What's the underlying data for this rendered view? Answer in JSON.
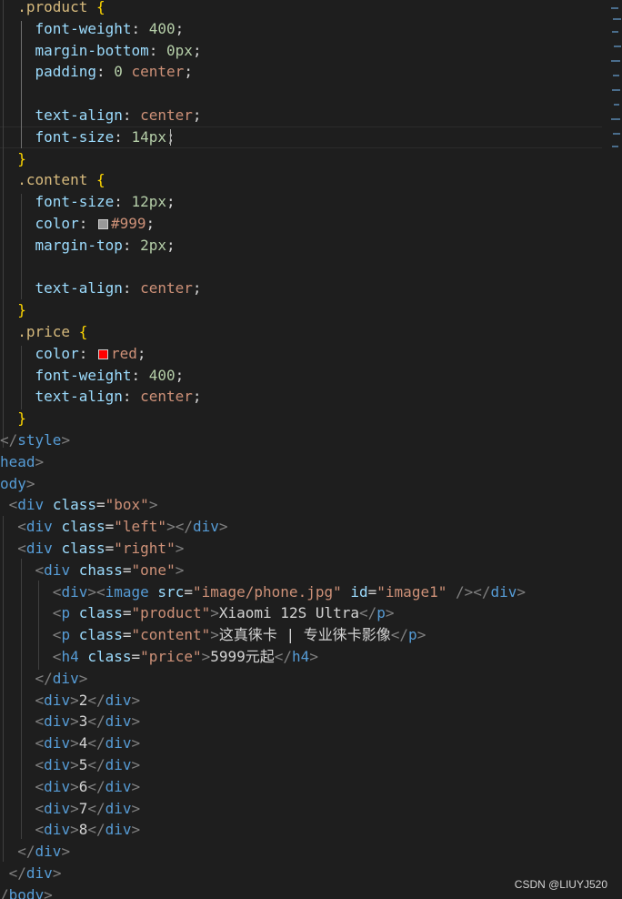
{
  "editor": {
    "lines": [
      {
        "indent": "  ",
        "tokens": [
          [
            "sel",
            ".product "
          ],
          [
            "brace",
            "{"
          ]
        ]
      },
      {
        "indent": "    ",
        "tokens": [
          [
            "prop",
            "font-weight"
          ],
          [
            "txt",
            ": "
          ],
          [
            "num",
            "400"
          ],
          [
            "txt",
            ";"
          ]
        ]
      },
      {
        "indent": "    ",
        "tokens": [
          [
            "prop",
            "margin-bottom"
          ],
          [
            "txt",
            ": "
          ],
          [
            "num",
            "0px"
          ],
          [
            "txt",
            ";"
          ]
        ]
      },
      {
        "indent": "    ",
        "tokens": [
          [
            "prop",
            "padding"
          ],
          [
            "txt",
            ": "
          ],
          [
            "num",
            "0"
          ],
          [
            "txt",
            " "
          ],
          [
            "val",
            "center"
          ],
          [
            "txt",
            ";"
          ]
        ]
      },
      {
        "indent": "",
        "tokens": []
      },
      {
        "indent": "    ",
        "tokens": [
          [
            "prop",
            "text-align"
          ],
          [
            "txt",
            ": "
          ],
          [
            "val",
            "center"
          ],
          [
            "txt",
            ";"
          ]
        ]
      },
      {
        "indent": "    ",
        "tokens": [
          [
            "prop",
            "font-size"
          ],
          [
            "txt",
            ": "
          ],
          [
            "num",
            "14px"
          ],
          [
            "txt",
            ";"
          ]
        ]
      },
      {
        "indent": "  ",
        "tokens": [
          [
            "brace",
            "}"
          ]
        ]
      },
      {
        "indent": "  ",
        "tokens": [
          [
            "sel",
            ".content "
          ],
          [
            "brace",
            "{"
          ]
        ]
      },
      {
        "indent": "    ",
        "tokens": [
          [
            "prop",
            "font-size"
          ],
          [
            "txt",
            ": "
          ],
          [
            "num",
            "12px"
          ],
          [
            "txt",
            ";"
          ]
        ]
      },
      {
        "indent": "    ",
        "tokens": [
          [
            "prop",
            "color"
          ],
          [
            "txt",
            ": "
          ],
          [
            "swatch",
            "#999999"
          ],
          [
            "val",
            "#999"
          ],
          [
            "txt",
            ";"
          ]
        ]
      },
      {
        "indent": "    ",
        "tokens": [
          [
            "prop",
            "margin-top"
          ],
          [
            "txt",
            ": "
          ],
          [
            "num",
            "2px"
          ],
          [
            "txt",
            ";"
          ]
        ]
      },
      {
        "indent": "",
        "tokens": []
      },
      {
        "indent": "    ",
        "tokens": [
          [
            "prop",
            "text-align"
          ],
          [
            "txt",
            ": "
          ],
          [
            "val",
            "center"
          ],
          [
            "txt",
            ";"
          ]
        ]
      },
      {
        "indent": "  ",
        "tokens": [
          [
            "brace",
            "}"
          ]
        ]
      },
      {
        "indent": "  ",
        "tokens": [
          [
            "sel",
            ".price "
          ],
          [
            "brace",
            "{"
          ]
        ]
      },
      {
        "indent": "    ",
        "tokens": [
          [
            "prop",
            "color"
          ],
          [
            "txt",
            ": "
          ],
          [
            "swatch",
            "#ff0000"
          ],
          [
            "val",
            "red"
          ],
          [
            "txt",
            ";"
          ]
        ]
      },
      {
        "indent": "    ",
        "tokens": [
          [
            "prop",
            "font-weight"
          ],
          [
            "txt",
            ": "
          ],
          [
            "num",
            "400"
          ],
          [
            "txt",
            ";"
          ]
        ]
      },
      {
        "indent": "    ",
        "tokens": [
          [
            "prop",
            "text-align"
          ],
          [
            "txt",
            ": "
          ],
          [
            "val",
            "center"
          ],
          [
            "txt",
            ";"
          ]
        ]
      },
      {
        "indent": "  ",
        "tokens": [
          [
            "brace",
            "}"
          ]
        ]
      },
      {
        "indent": "",
        "tokens": [
          [
            "bracket",
            "</"
          ],
          [
            "tag",
            "style"
          ],
          [
            "bracket",
            ">"
          ]
        ]
      },
      {
        "indent": "",
        "tokens": [
          [
            "tag",
            "head"
          ],
          [
            "bracket",
            ">"
          ]
        ]
      },
      {
        "indent": "",
        "tokens": [
          [
            "tag",
            "ody"
          ],
          [
            "bracket",
            ">"
          ]
        ]
      },
      {
        "indent": " ",
        "tokens": [
          [
            "bracket",
            "<"
          ],
          [
            "tag",
            "div"
          ],
          [
            "txt",
            " "
          ],
          [
            "attr",
            "class"
          ],
          [
            "txt",
            "="
          ],
          [
            "str",
            "\"box\""
          ],
          [
            "bracket",
            ">"
          ]
        ]
      },
      {
        "indent": "  ",
        "tokens": [
          [
            "bracket",
            "<"
          ],
          [
            "tag",
            "div"
          ],
          [
            "txt",
            " "
          ],
          [
            "attr",
            "class"
          ],
          [
            "txt",
            "="
          ],
          [
            "str",
            "\"left\""
          ],
          [
            "bracket",
            "></"
          ],
          [
            "tag",
            "div"
          ],
          [
            "bracket",
            ">"
          ]
        ]
      },
      {
        "indent": "  ",
        "tokens": [
          [
            "bracket",
            "<"
          ],
          [
            "tag",
            "div"
          ],
          [
            "txt",
            " "
          ],
          [
            "attr",
            "class"
          ],
          [
            "txt",
            "="
          ],
          [
            "str",
            "\"right\""
          ],
          [
            "bracket",
            ">"
          ]
        ]
      },
      {
        "indent": "    ",
        "tokens": [
          [
            "bracket",
            "<"
          ],
          [
            "tag",
            "div"
          ],
          [
            "txt",
            " "
          ],
          [
            "attr",
            "chass"
          ],
          [
            "txt",
            "="
          ],
          [
            "str",
            "\"one\""
          ],
          [
            "bracket",
            ">"
          ]
        ]
      },
      {
        "indent": "      ",
        "tokens": [
          [
            "bracket",
            "<"
          ],
          [
            "tag",
            "div"
          ],
          [
            "bracket",
            "><"
          ],
          [
            "tag",
            "image"
          ],
          [
            "txt",
            " "
          ],
          [
            "attr",
            "src"
          ],
          [
            "txt",
            "="
          ],
          [
            "str",
            "\"image/phone.jpg\""
          ],
          [
            "txt",
            " "
          ],
          [
            "attr",
            "id"
          ],
          [
            "txt",
            "="
          ],
          [
            "str",
            "\"image1\""
          ],
          [
            "txt",
            " "
          ],
          [
            "bracket",
            "/></"
          ],
          [
            "tag",
            "div"
          ],
          [
            "bracket",
            ">"
          ]
        ]
      },
      {
        "indent": "      ",
        "tokens": [
          [
            "bracket",
            "<"
          ],
          [
            "tag",
            "p"
          ],
          [
            "txt",
            " "
          ],
          [
            "attr",
            "class"
          ],
          [
            "txt",
            "="
          ],
          [
            "str",
            "\"product\""
          ],
          [
            "bracket",
            ">"
          ],
          [
            "txt",
            "Xiaomi 12S Ultra"
          ],
          [
            "bracket",
            "</"
          ],
          [
            "tag",
            "p"
          ],
          [
            "bracket",
            ">"
          ]
        ]
      },
      {
        "indent": "      ",
        "tokens": [
          [
            "bracket",
            "<"
          ],
          [
            "tag",
            "p"
          ],
          [
            "txt",
            " "
          ],
          [
            "attr",
            "class"
          ],
          [
            "txt",
            "="
          ],
          [
            "str",
            "\"content\""
          ],
          [
            "bracket",
            ">"
          ],
          [
            "txt",
            "这真徕卡 | 专业徕卡影像"
          ],
          [
            "bracket",
            "</"
          ],
          [
            "tag",
            "p"
          ],
          [
            "bracket",
            ">"
          ]
        ]
      },
      {
        "indent": "      ",
        "tokens": [
          [
            "bracket",
            "<"
          ],
          [
            "tag",
            "h4"
          ],
          [
            "txt",
            " "
          ],
          [
            "attr",
            "class"
          ],
          [
            "txt",
            "="
          ],
          [
            "str",
            "\"price\""
          ],
          [
            "bracket",
            ">"
          ],
          [
            "txt",
            "5999元起"
          ],
          [
            "bracket",
            "</"
          ],
          [
            "tag",
            "h4"
          ],
          [
            "bracket",
            ">"
          ]
        ]
      },
      {
        "indent": "    ",
        "tokens": [
          [
            "bracket",
            "</"
          ],
          [
            "tag",
            "div"
          ],
          [
            "bracket",
            ">"
          ]
        ]
      },
      {
        "indent": "    ",
        "tokens": [
          [
            "bracket",
            "<"
          ],
          [
            "tag",
            "div"
          ],
          [
            "bracket",
            ">"
          ],
          [
            "txt",
            "2"
          ],
          [
            "bracket",
            "</"
          ],
          [
            "tag",
            "div"
          ],
          [
            "bracket",
            ">"
          ]
        ]
      },
      {
        "indent": "    ",
        "tokens": [
          [
            "bracket",
            "<"
          ],
          [
            "tag",
            "div"
          ],
          [
            "bracket",
            ">"
          ],
          [
            "txt",
            "3"
          ],
          [
            "bracket",
            "</"
          ],
          [
            "tag",
            "div"
          ],
          [
            "bracket",
            ">"
          ]
        ]
      },
      {
        "indent": "    ",
        "tokens": [
          [
            "bracket",
            "<"
          ],
          [
            "tag",
            "div"
          ],
          [
            "bracket",
            ">"
          ],
          [
            "txt",
            "4"
          ],
          [
            "bracket",
            "</"
          ],
          [
            "tag",
            "div"
          ],
          [
            "bracket",
            ">"
          ]
        ]
      },
      {
        "indent": "    ",
        "tokens": [
          [
            "bracket",
            "<"
          ],
          [
            "tag",
            "div"
          ],
          [
            "bracket",
            ">"
          ],
          [
            "txt",
            "5"
          ],
          [
            "bracket",
            "</"
          ],
          [
            "tag",
            "div"
          ],
          [
            "bracket",
            ">"
          ]
        ]
      },
      {
        "indent": "    ",
        "tokens": [
          [
            "bracket",
            "<"
          ],
          [
            "tag",
            "div"
          ],
          [
            "bracket",
            ">"
          ],
          [
            "txt",
            "6"
          ],
          [
            "bracket",
            "</"
          ],
          [
            "tag",
            "div"
          ],
          [
            "bracket",
            ">"
          ]
        ]
      },
      {
        "indent": "    ",
        "tokens": [
          [
            "bracket",
            "<"
          ],
          [
            "tag",
            "div"
          ],
          [
            "bracket",
            ">"
          ],
          [
            "txt",
            "7"
          ],
          [
            "bracket",
            "</"
          ],
          [
            "tag",
            "div"
          ],
          [
            "bracket",
            ">"
          ]
        ]
      },
      {
        "indent": "    ",
        "tokens": [
          [
            "bracket",
            "<"
          ],
          [
            "tag",
            "div"
          ],
          [
            "bracket",
            ">"
          ],
          [
            "txt",
            "8"
          ],
          [
            "bracket",
            "</"
          ],
          [
            "tag",
            "div"
          ],
          [
            "bracket",
            ">"
          ]
        ]
      },
      {
        "indent": "  ",
        "tokens": [
          [
            "bracket",
            "</"
          ],
          [
            "tag",
            "div"
          ],
          [
            "bracket",
            ">"
          ]
        ]
      },
      {
        "indent": " ",
        "tokens": [
          [
            "bracket",
            "</"
          ],
          [
            "tag",
            "div"
          ],
          [
            "bracket",
            ">"
          ]
        ]
      },
      {
        "indent": "",
        "tokens": [
          [
            "bracket",
            "/"
          ],
          [
            "tag",
            "body"
          ],
          [
            "bracket",
            ">"
          ]
        ]
      }
    ]
  },
  "watermark": "CSDN @LIUYJ520",
  "colors": {
    "background": "#1e1e1e",
    "selector": "#d7ba7d",
    "brace": "#ffd700",
    "property": "#9cdcfe",
    "number": "#b5cea8",
    "value": "#ce9178",
    "tag": "#569cd6",
    "bracket": "#808080",
    "text": "#d4d4d4"
  }
}
